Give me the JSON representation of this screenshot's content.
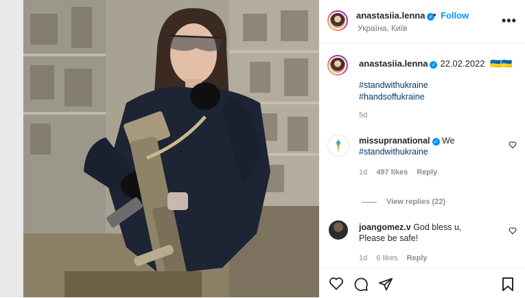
{
  "post": {
    "author": "anastasiia.lenna",
    "follow_label": "Follow",
    "separator": "•",
    "location": "Україна, Київ",
    "more_label": "•••"
  },
  "caption": {
    "author": "anastasiia.lenna",
    "date": "22.02.2022",
    "flags": "🇺🇦🇺🇦",
    "hashtags": [
      "#standwithukraine",
      "#handsoffukraine"
    ],
    "age": "5d"
  },
  "comments": [
    {
      "author": "missupranational",
      "text_line1": "We",
      "text_line2": "#standwithukraine",
      "time": "1d",
      "likes": "497 likes",
      "reply_label": "Reply"
    },
    {
      "author": "joangomez.v",
      "text_line1": "God bless u,",
      "text_line2": "Please be safe!",
      "time": "1d",
      "likes": "6 likes",
      "reply_label": "Reply"
    }
  ],
  "view_replies_label": "View replies (22)",
  "icons": {
    "verified": "verified-badge-icon",
    "like": "heart-icon",
    "comment": "comment-icon",
    "share": "send-icon",
    "save": "bookmark-icon",
    "next": "chevron-right-icon"
  },
  "colors": {
    "link": "#0095f6",
    "hashtag": "#00376b",
    "muted": "#8e8e8e"
  }
}
